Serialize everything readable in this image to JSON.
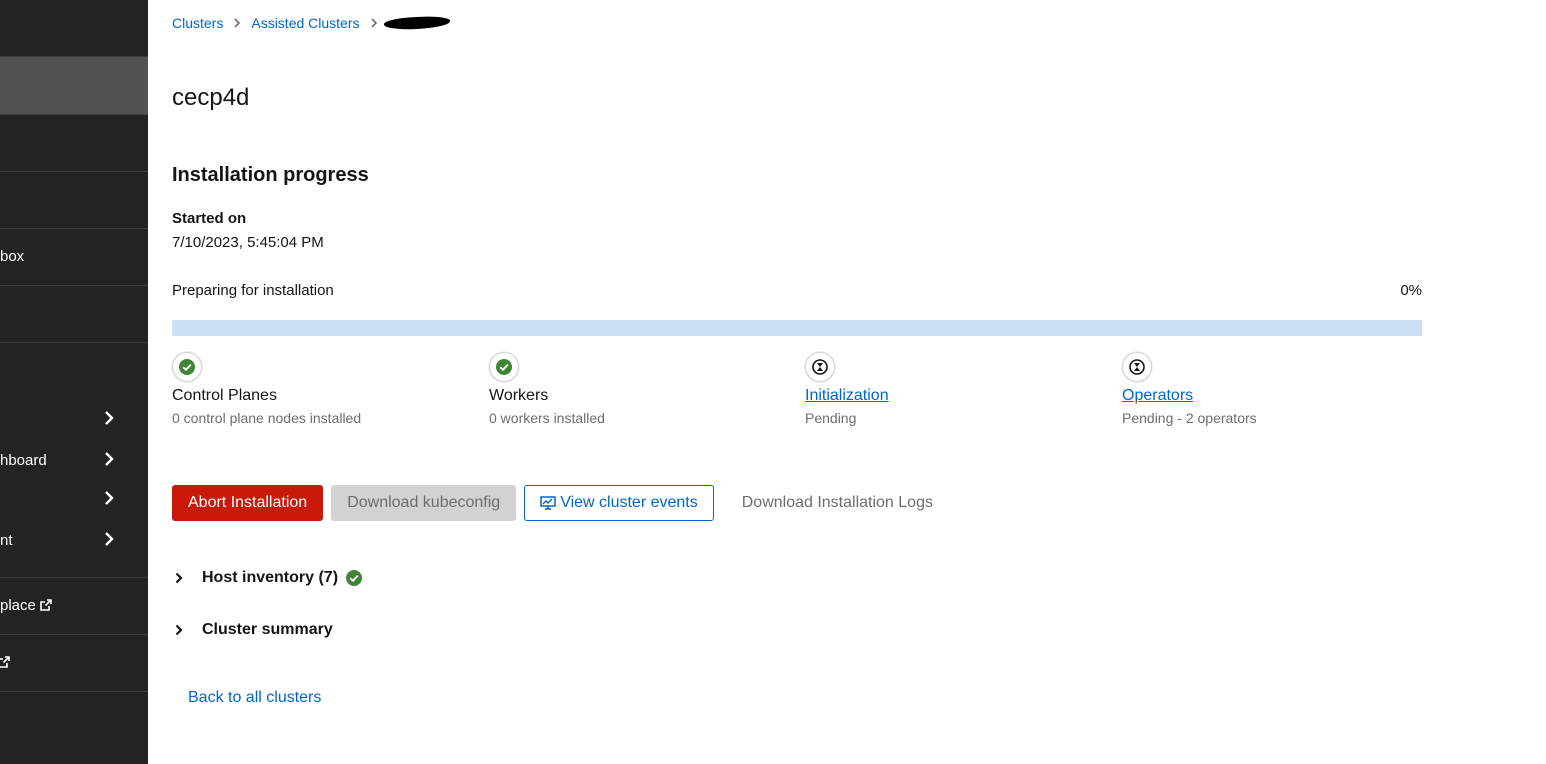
{
  "sidebar": {
    "items": [
      {
        "label": "box"
      },
      {
        "label": ""
      },
      {
        "label": "hboard"
      },
      {
        "label": ""
      },
      {
        "label": "nt"
      },
      {
        "label": "place"
      },
      {
        "label": ""
      }
    ]
  },
  "breadcrumb": {
    "items": [
      "Clusters",
      "Assisted Clusters"
    ]
  },
  "page": {
    "title": "cecp4d"
  },
  "progress": {
    "section_title": "Installation progress",
    "started_label": "Started on",
    "started_value": "7/10/2023, 5:45:04 PM",
    "status_label": "Preparing for installation",
    "percent_label": "0%",
    "percent_value": 0,
    "colors": {
      "track": "#cce0f5",
      "fill": "#0066cc",
      "success": "#3e8635"
    }
  },
  "steps": [
    {
      "title": "Control Planes",
      "subtitle": "0 control plane nodes installed",
      "status": "completed",
      "icon": "check-circle-icon"
    },
    {
      "title": "Workers",
      "subtitle": "0 workers installed",
      "status": "completed",
      "icon": "check-circle-icon"
    },
    {
      "title": "Initialization",
      "subtitle": "Pending",
      "status": "pending",
      "icon": "hourglass-icon"
    },
    {
      "title": "Operators",
      "subtitle": "Pending - 2 operators",
      "status": "pending",
      "icon": "hourglass-icon"
    }
  ],
  "actions": {
    "abort_label": "Abort Installation",
    "kubeconfig_label": "Download kubeconfig",
    "events_label": "View cluster events",
    "logs_label": "Download Installation Logs"
  },
  "sections": {
    "host_inventory_label": "Host inventory (7)",
    "cluster_summary_label": "Cluster summary"
  },
  "footer": {
    "back_label": "Back to all clusters"
  }
}
